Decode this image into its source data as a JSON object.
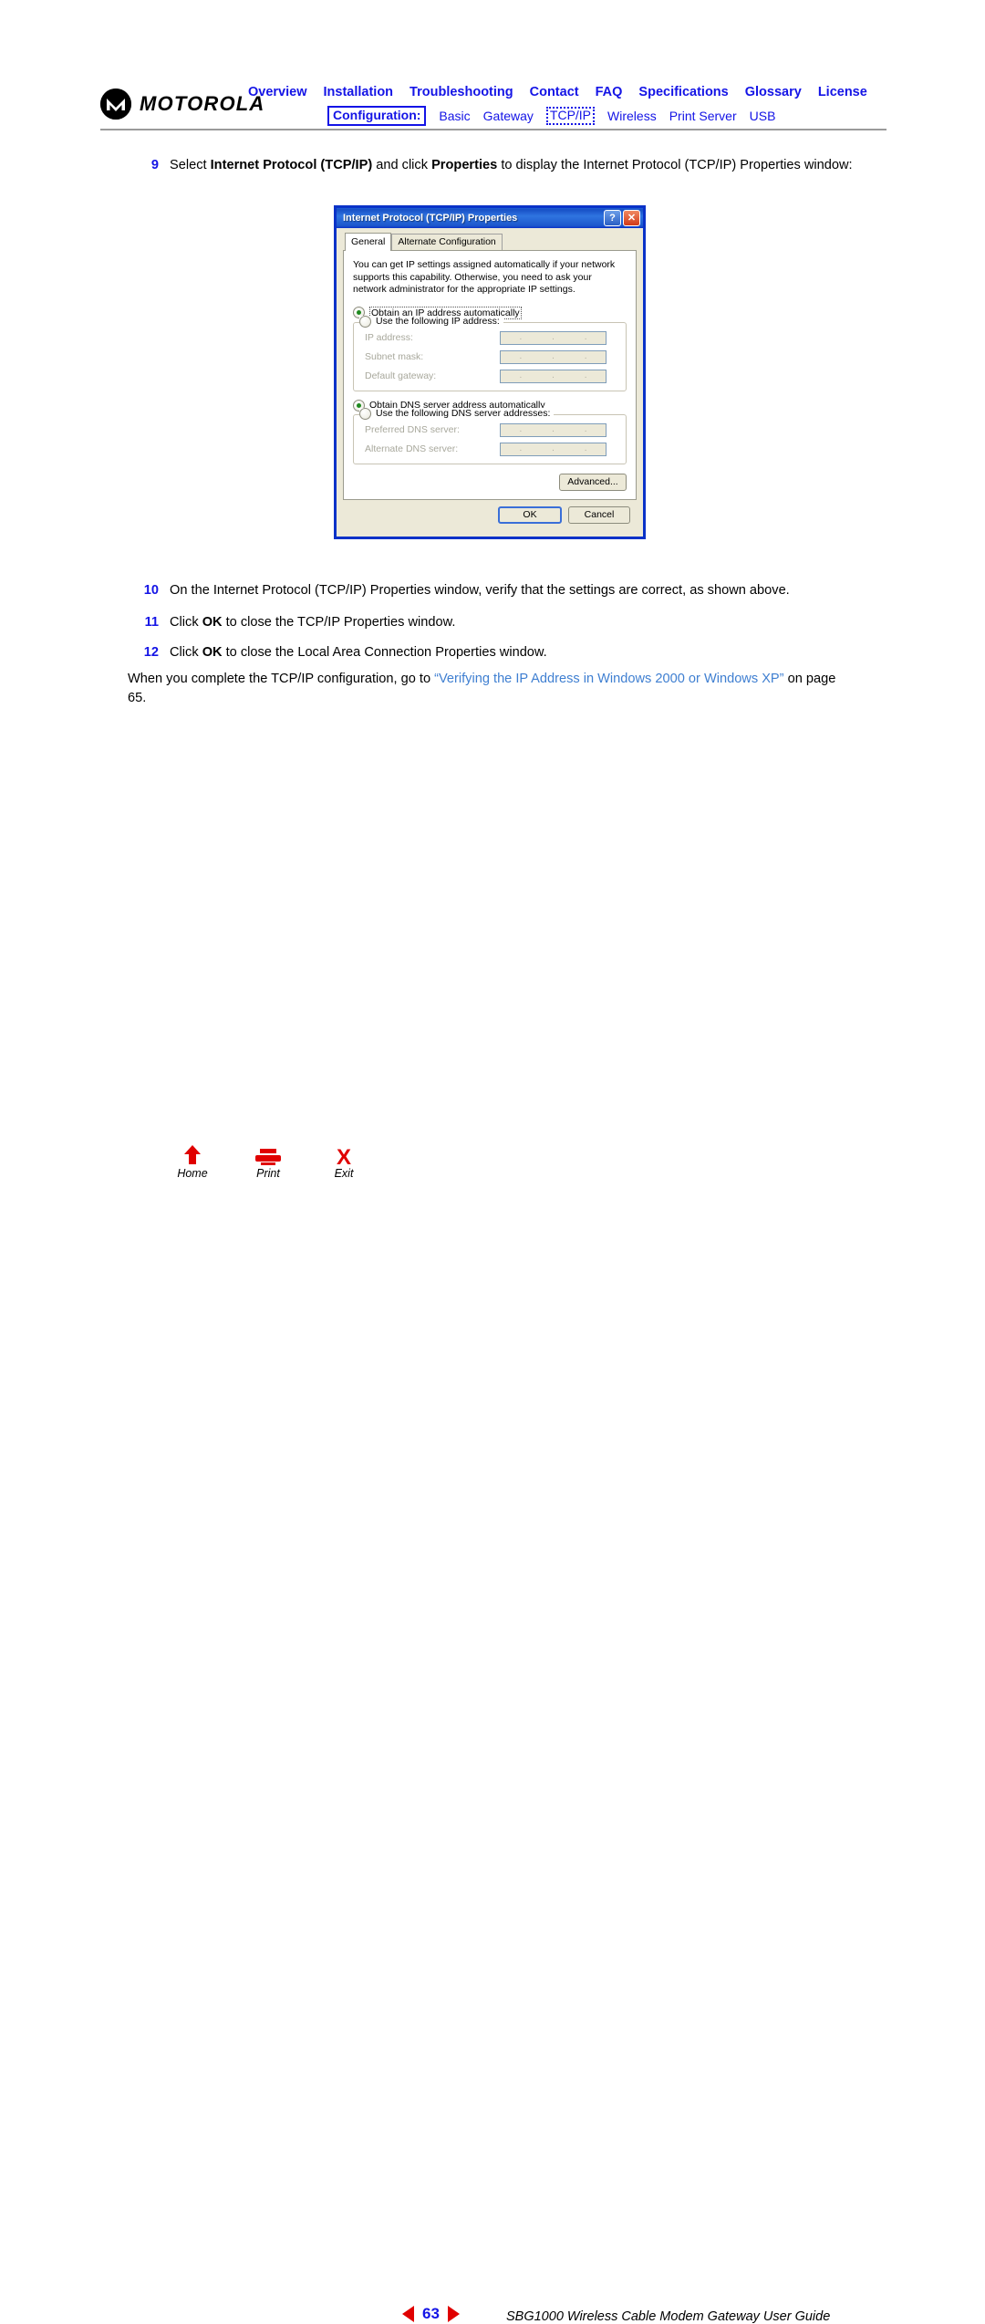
{
  "header": {
    "brand": "MOTOROLA",
    "logo_icon": "motorola-batwing-logo",
    "nav_primary": [
      "Overview",
      "Installation",
      "Troubleshooting",
      "Contact",
      "FAQ",
      "Specifications",
      "Glossary",
      "License"
    ],
    "config_label": "Configuration:",
    "nav_secondary": [
      "Basic",
      "Gateway",
      "TCP/IP",
      "Wireless",
      "Print Server",
      "USB"
    ],
    "current_section": "TCP/IP"
  },
  "steps": [
    {
      "num": "9",
      "parts": [
        {
          "t": "Select ",
          "b": false
        },
        {
          "t": "Internet Protocol (TCP/IP)",
          "b": true
        },
        {
          "t": " and click ",
          "b": false
        },
        {
          "t": "Properties",
          "b": true
        },
        {
          "t": " to display the Internet Protocol (TCP/IP) Properties window:",
          "b": false
        }
      ]
    },
    {
      "num": "10",
      "parts": [
        {
          "t": "On the Internet Protocol (TCP/IP) Properties window, verify that the settings are correct, as shown above.",
          "b": false
        }
      ]
    },
    {
      "num": "11",
      "parts": [
        {
          "t": "Click ",
          "b": false
        },
        {
          "t": "OK",
          "b": true
        },
        {
          "t": " to close the TCP/IP Properties window.",
          "b": false
        }
      ]
    },
    {
      "num": "12",
      "parts": [
        {
          "t": "Click ",
          "b": false
        },
        {
          "t": "OK",
          "b": true
        },
        {
          "t": " to close the Local Area Connection Properties window.",
          "b": false
        }
      ]
    }
  ],
  "closing_paragraph": {
    "before": "When you complete the TCP/IP configuration, go to ",
    "link": "“Verifying the IP Address in Windows 2000 or Windows XP”",
    "after": " on page 65."
  },
  "dialog": {
    "title": "Internet Protocol (TCP/IP) Properties",
    "help_button": "?",
    "close_button": "✕",
    "tabs": [
      {
        "label": "General",
        "active": true
      },
      {
        "label": "Alternate Configuration",
        "active": false
      }
    ],
    "description": "You can get IP settings assigned automatically if your network supports this capability. Otherwise, you need to ask your network administrator for the appropriate IP settings.",
    "ip_section": {
      "auto_option": "Obtain an IP address automatically",
      "auto_selected": true,
      "manual_option": "Use the following IP address:",
      "manual_selected": false,
      "fields": [
        {
          "label": "IP address:",
          "value": ""
        },
        {
          "label": "Subnet mask:",
          "value": ""
        },
        {
          "label": "Default gateway:",
          "value": ""
        }
      ]
    },
    "dns_section": {
      "auto_option": "Obtain DNS server address automatically",
      "auto_selected": true,
      "manual_option": "Use the following DNS server addresses:",
      "manual_selected": false,
      "fields": [
        {
          "label": "Preferred DNS server:",
          "value": ""
        },
        {
          "label": "Alternate DNS server:",
          "value": ""
        }
      ]
    },
    "advanced_button": "Advanced...",
    "ok_button": "OK",
    "cancel_button": "Cancel"
  },
  "footer": {
    "buttons": [
      {
        "label": "Home",
        "icon": "home-arrow-icon"
      },
      {
        "label": "Print",
        "icon": "printer-icon"
      },
      {
        "label": "Exit",
        "icon": "x-close-icon"
      }
    ],
    "prev_icon": "left-triangle-icon",
    "next_icon": "right-triangle-icon",
    "page_number": "63",
    "guide_title": "SBG1000 Wireless Cable Modem Gateway User Guide"
  },
  "colors": {
    "nav_blue": "#1414e6",
    "link_blue": "#3f7fd1",
    "accent_red": "#e00000",
    "dialog_border": "#0a32c8",
    "dialog_face": "#ece9d8"
  }
}
